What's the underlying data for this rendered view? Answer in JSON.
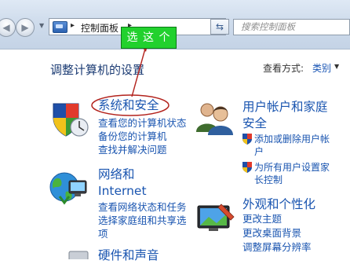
{
  "toolbar": {
    "back_glyph": "◀",
    "forward_glyph": "▶",
    "address_separator": "▸",
    "address_crumb": "控制面板",
    "address_trailing_separator": "▸",
    "address_dropdown_glyph": "▼",
    "refresh_glyph": "⇆",
    "search_placeholder": "搜索控制面板"
  },
  "annotation": {
    "callout_text": "选 这 个",
    "callout_color": "#22d12e",
    "arrow_color": "#b3231d"
  },
  "header": {
    "title": "调整计算机的设置",
    "view_label": "查看方式:",
    "view_value": "类别",
    "view_dropdown_glyph": "▼"
  },
  "categories": {
    "system_security": {
      "title": "系统和安全",
      "links": [
        "查看您的计算机状态",
        "备份您的计算机",
        "查找并解决问题"
      ]
    },
    "network": {
      "title_line1": "网络和",
      "title_line2": "Internet",
      "links": [
        "查看网络状态和任务",
        "选择家庭组和共享选",
        "项"
      ]
    },
    "hardware": {
      "title": "硬件和声音"
    },
    "user_accounts": {
      "title_line1": "用户帐户和家庭",
      "title_line2": "安全",
      "links": [
        {
          "line1": "添加或删除用户帐",
          "line2": "户"
        },
        {
          "line1": "为所有用户设置家",
          "line2": "长控制"
        }
      ]
    },
    "appearance": {
      "title": "外观和个性化",
      "links": [
        "更改主题",
        "更改桌面背景",
        "调整屏幕分辨率"
      ]
    }
  }
}
